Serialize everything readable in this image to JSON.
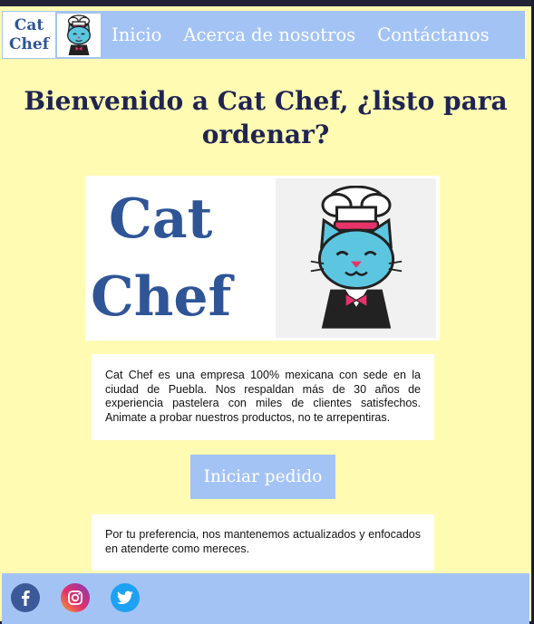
{
  "brand": {
    "line1": "Cat",
    "line2": "Chef"
  },
  "nav": {
    "items": [
      {
        "label": "Inicio"
      },
      {
        "label": "Acerca de nosotros"
      },
      {
        "label": "Contáctanos"
      }
    ]
  },
  "headline": "Bienvenido a Cat Chef, ¿listo para ordenar?",
  "hero": {
    "logo_line1": "Cat",
    "logo_line2": "Chef"
  },
  "intro_text": "Cat Chef es una empresa 100% mexicana con sede en la ciudad de Puebla. Nos respaldan más de 30 años de experiencia pastelera con miles de clientes satisfechos. Animate a probar nuestros productos, no te arrepentiras.",
  "order_button": "Iniciar pedido",
  "preference_text": "Por tu preferencia, nos mantenemos actualizados y enfocados en atenderte como mereces.",
  "footer": {
    "icons": [
      "facebook-icon",
      "instagram-icon",
      "twitter-icon"
    ]
  },
  "colors": {
    "background": "#fffbb3",
    "accent": "#a4c3f5",
    "brand_blue": "#2f5597",
    "headline": "#1f2452",
    "cat": "#5cc6e0"
  }
}
